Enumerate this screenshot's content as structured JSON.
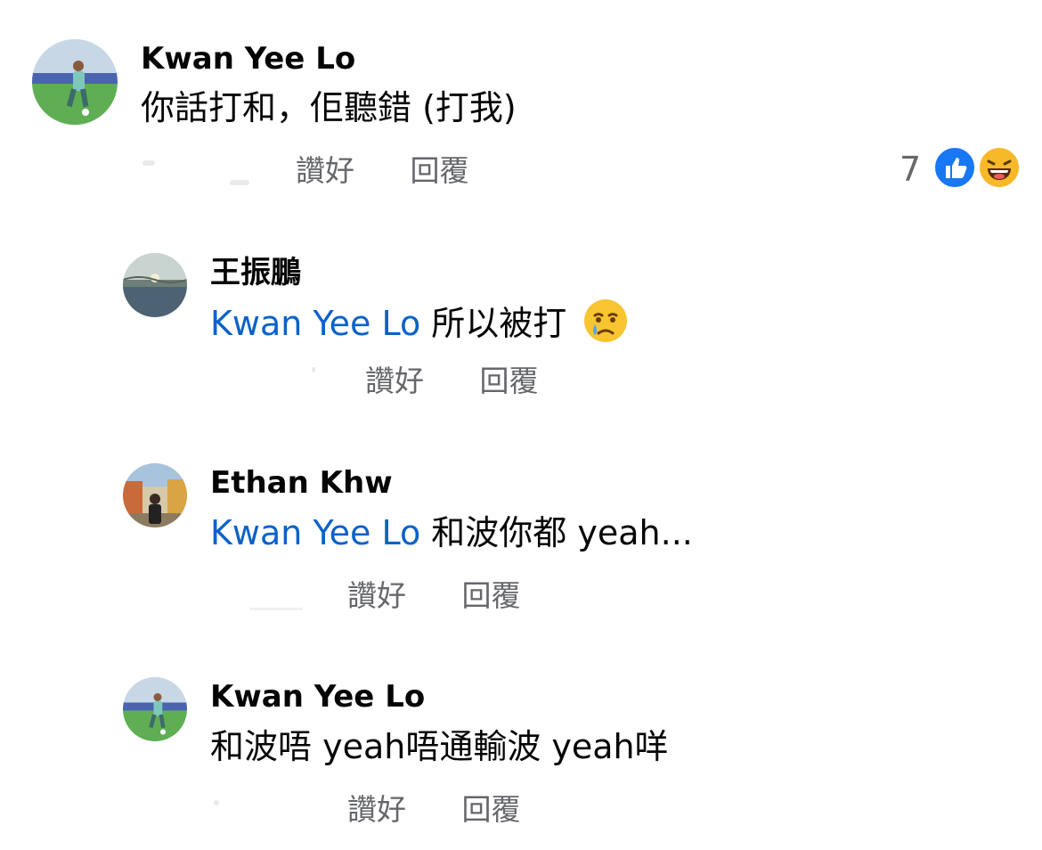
{
  "comments": [
    {
      "author": "Kwan Yee Lo",
      "mention": "",
      "text": "你話打和，佢聽錯 (打我)",
      "like_label": "讚好",
      "reply_label": "回覆",
      "reactions": {
        "count": "7",
        "icons": [
          "like-icon",
          "laugh-icon"
        ]
      }
    },
    {
      "author": "王振鵬",
      "mention": "Kwan Yee Lo",
      "text": "所以被打",
      "emoji": "crying-face-icon",
      "like_label": "讚好",
      "reply_label": "回覆"
    },
    {
      "author": "Ethan Khw",
      "mention": "Kwan Yee Lo",
      "text": "和波你都 yeah...",
      "like_label": "讚好",
      "reply_label": "回覆"
    },
    {
      "author": "Kwan Yee Lo",
      "mention": "",
      "text": "和波唔 yeah唔通輸波 yeah咩",
      "like_label": "讚好",
      "reply_label": "回覆"
    }
  ],
  "colors": {
    "mention": "#0a62c9",
    "action_text": "#65676b",
    "like_blue": "#1877f2",
    "laugh_yellow": "#f7b928"
  }
}
